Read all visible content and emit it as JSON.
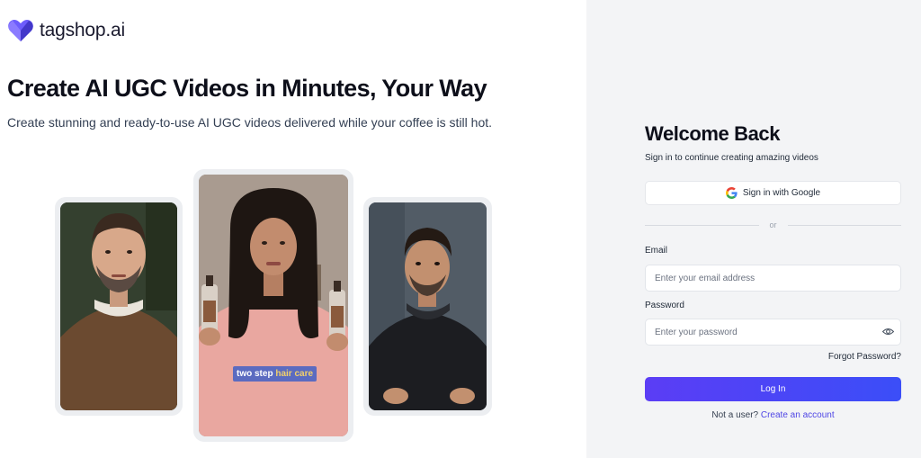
{
  "brand": {
    "name": "tagshop.ai",
    "logo_colors": [
      "#7c3aed",
      "#4f46e5",
      "#6366f1"
    ]
  },
  "hero": {
    "headline": "Create AI UGC Videos in Minutes, Your Way",
    "subheadline": "Create stunning and ready-to-use AI UGC videos delivered while your coffee is still hot."
  },
  "videos": [
    {
      "subject": "man-with-beard"
    },
    {
      "subject": "woman-holding-products",
      "caption_part1": "two step",
      "caption_part2": "hair care"
    },
    {
      "subject": "man-in-hoodie"
    }
  ],
  "login": {
    "title": "Welcome Back",
    "subtitle": "Sign in to continue creating amazing videos",
    "google_label": "Sign in with Google",
    "divider_text": "or",
    "email_label": "Email",
    "email_placeholder": "Enter your email address",
    "email_value": "",
    "password_label": "Password",
    "password_placeholder": "Enter your password",
    "password_value": "",
    "forgot_label": "Forgot Password?",
    "submit_label": "Log In",
    "signup_prompt": "Not a user?",
    "signup_link": "Create an account",
    "accent_color": "#4f46e5"
  }
}
